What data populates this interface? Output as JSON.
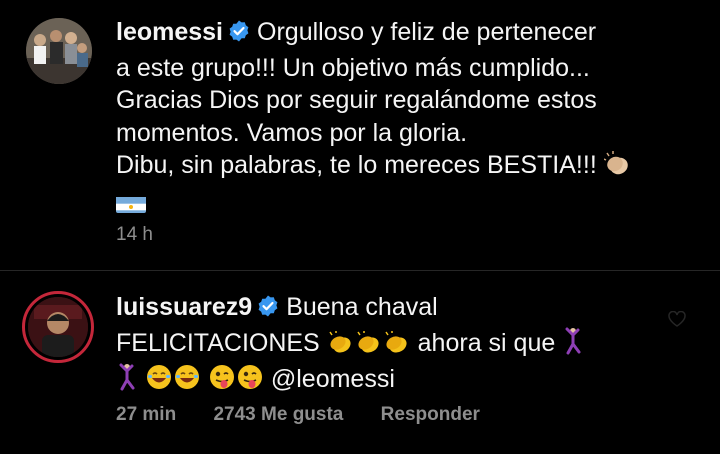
{
  "post": {
    "username": "leomessi",
    "caption_lines": [
      "Orgulloso y feliz de pertenecer",
      "a este grupo!!! Un objetivo más cumplido...",
      "Gracias Dios por seguir regalándome estos",
      "momentos. Vamos por la gloria.",
      "Dibu, sin palabras, te lo mereces BESTIA!!!"
    ],
    "time": "14 h"
  },
  "comment": {
    "username": "luissuarez9",
    "text_1": "Buena chaval",
    "text_2": "FELICITACIONES",
    "text_3": "ahora si que",
    "mention": "@leomessi",
    "time": "27 min",
    "likes": "2743 Me gusta",
    "reply_label": "Responder"
  },
  "colors": {
    "background": "#000000",
    "text": "#f5f5f5",
    "muted": "#8e8e8e",
    "verified": "#3897f0",
    "divider": "#262626"
  },
  "icons": [
    "verified-badge-icon",
    "clapping-hands-emoji",
    "argentina-flag-emoji",
    "dancing-man-emoji",
    "laughing-face-emoji",
    "winking-tongue-emoji",
    "heart-icon"
  ]
}
